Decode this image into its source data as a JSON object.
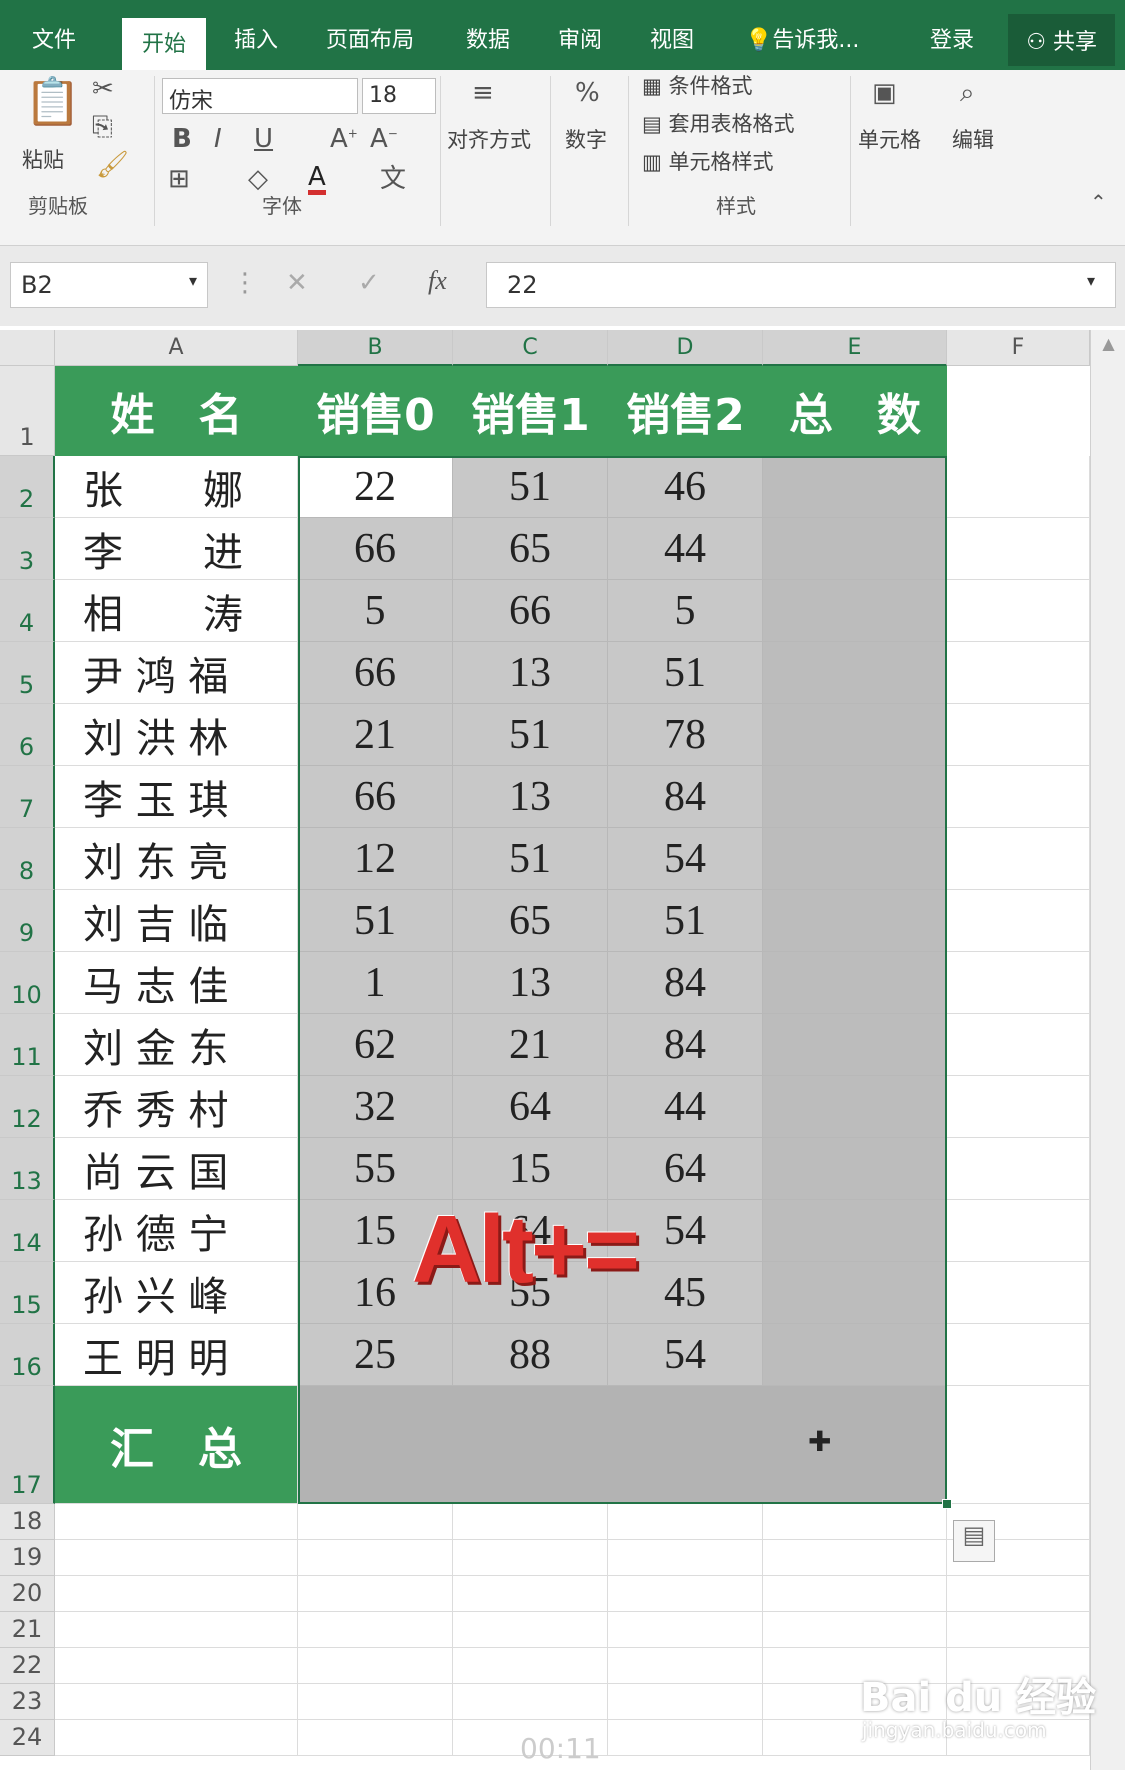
{
  "ribbon_tabs": [
    "文件",
    "开始",
    "插入",
    "页面布局",
    "数据",
    "审阅",
    "视图",
    "告诉我...",
    "登录"
  ],
  "share_label": "共享",
  "clipboard": {
    "paste": "粘贴",
    "group": "剪贴板"
  },
  "font": {
    "name": "仿宋",
    "size": "18",
    "group": "字体"
  },
  "alignment_label": "对齐方式",
  "number_label": "数字",
  "styles": {
    "conditional": "条件格式",
    "table": "套用表格格式",
    "cell_style": "单元格样式",
    "group": "样式"
  },
  "cells_label": "单元格",
  "editing_label": "编辑",
  "formula_bar": {
    "name_box": "B2",
    "fx": "fx",
    "value": "22"
  },
  "columns": [
    "A",
    "B",
    "C",
    "D",
    "E",
    "F"
  ],
  "rows": [
    "1",
    "2",
    "3",
    "4",
    "5",
    "6",
    "7",
    "8",
    "9",
    "10",
    "11",
    "12",
    "13",
    "14",
    "15",
    "16",
    "17",
    "18",
    "19",
    "20",
    "21",
    "22",
    "23",
    "24"
  ],
  "headers": [
    "姓　名",
    "销售0",
    "销售1",
    "销售2",
    "总　数"
  ],
  "data": [
    {
      "name": "张　　娜",
      "s0": "22",
      "s1": "51",
      "s2": "46"
    },
    {
      "name": "李　　进",
      "s0": "66",
      "s1": "65",
      "s2": "44"
    },
    {
      "name": "相　　涛",
      "s0": "5",
      "s1": "66",
      "s2": "5"
    },
    {
      "name": "尹 鸿 福",
      "s0": "66",
      "s1": "13",
      "s2": "51"
    },
    {
      "name": "刘 洪 林",
      "s0": "21",
      "s1": "51",
      "s2": "78"
    },
    {
      "name": "李 玉 琪",
      "s0": "66",
      "s1": "13",
      "s2": "84"
    },
    {
      "name": "刘 东 亮",
      "s0": "12",
      "s1": "51",
      "s2": "54"
    },
    {
      "name": "刘 吉 临",
      "s0": "51",
      "s1": "65",
      "s2": "51"
    },
    {
      "name": "马 志 佳",
      "s0": "1",
      "s1": "13",
      "s2": "84"
    },
    {
      "name": "刘 金 东",
      "s0": "62",
      "s1": "21",
      "s2": "84"
    },
    {
      "name": "乔 秀 村",
      "s0": "32",
      "s1": "64",
      "s2": "44"
    },
    {
      "name": "尚 云 国",
      "s0": "55",
      "s1": "15",
      "s2": "64"
    },
    {
      "name": "孙 德 宁",
      "s0": "15",
      "s1": "64",
      "s2": "54"
    },
    {
      "name": "孙 兴 峰",
      "s0": "16",
      "s1": "55",
      "s2": "45"
    },
    {
      "name": "王 明 明",
      "s0": "25",
      "s1": "88",
      "s2": "54"
    }
  ],
  "summary_label": "汇　总",
  "overlay_text": "Alt+=",
  "watermark": {
    "brand": "Bai du 经验",
    "url": "jingyan.baidu.com"
  },
  "timer": "00:11",
  "colors": {
    "excel_green": "#217346",
    "header_green": "#3a9b59",
    "selection_gray": "#c8c8c8",
    "overlay_red": "#e0302c"
  }
}
